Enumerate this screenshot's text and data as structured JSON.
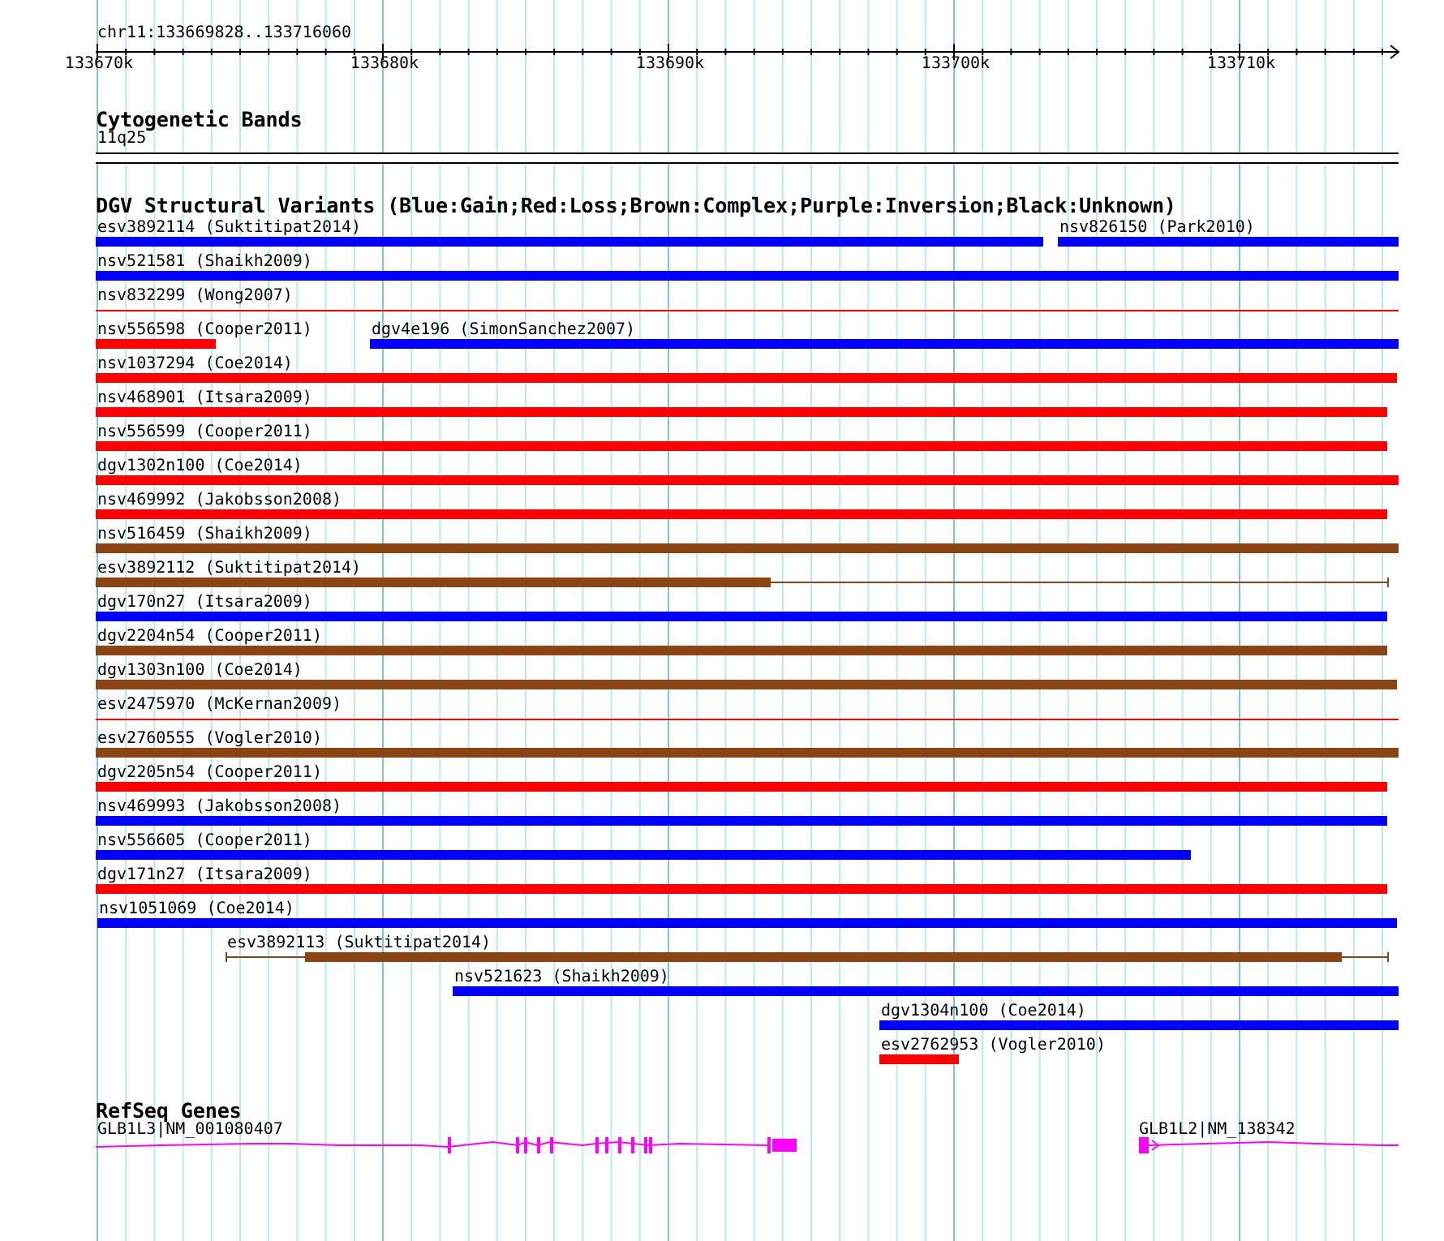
{
  "locus": "chr11:133669828..133716060",
  "ruler": {
    "labels": [
      "133670k",
      "133680k",
      "133690k",
      "133700k",
      "133710k"
    ]
  },
  "cytoband_track": {
    "title": "Cytogenetic Bands",
    "band": "11q25"
  },
  "variants_track": {
    "title": "DGV Structural Variants (Blue:Gain;Red:Loss;Brown:Complex;Purple:Inversion;Black:Unknown)",
    "rows": [
      {
        "features": [
          {
            "label": "esv3892114 (Suktitipat2014)",
            "color": "#0000ff",
            "kind": "bar"
          },
          {
            "label": "nsv826150 (Park2010)",
            "color": "#0000ff",
            "kind": "bar"
          }
        ]
      },
      {
        "features": [
          {
            "label": "nsv521581 (Shaikh2009)",
            "color": "#0000ff",
            "kind": "bar"
          }
        ]
      },
      {
        "features": [
          {
            "label": "nsv832299 (Wong2007)",
            "color": "#ff0000",
            "kind": "line"
          }
        ]
      },
      {
        "features": [
          {
            "label": "nsv556598 (Cooper2011)",
            "color": "#ff0000",
            "kind": "bar"
          },
          {
            "label": "dgv4e196 (SimonSanchez2007)",
            "color": "#0000ff",
            "kind": "bar"
          }
        ]
      },
      {
        "features": [
          {
            "label": "nsv1037294 (Coe2014)",
            "color": "#ff0000",
            "kind": "bar"
          }
        ]
      },
      {
        "features": [
          {
            "label": "nsv468901 (Itsara2009)",
            "color": "#ff0000",
            "kind": "bar"
          }
        ]
      },
      {
        "features": [
          {
            "label": "nsv556599 (Cooper2011)",
            "color": "#ff0000",
            "kind": "bar"
          }
        ]
      },
      {
        "features": [
          {
            "label": "dgv1302n100 (Coe2014)",
            "color": "#ff0000",
            "kind": "bar"
          }
        ]
      },
      {
        "features": [
          {
            "label": "nsv469992 (Jakobsson2008)",
            "color": "#ff0000",
            "kind": "bar"
          }
        ]
      },
      {
        "features": [
          {
            "label": "nsv516459 (Shaikh2009)",
            "color": "#8b4513",
            "kind": "bar"
          }
        ]
      },
      {
        "features": [
          {
            "label": "esv3892112 (Suktitipat2014)",
            "color": "#8b4513",
            "kind": "split"
          }
        ]
      },
      {
        "features": [
          {
            "label": "dgv170n27 (Itsara2009)",
            "color": "#0000ff",
            "kind": "bar"
          }
        ]
      },
      {
        "features": [
          {
            "label": "dgv2204n54 (Cooper2011)",
            "color": "#8b4513",
            "kind": "bar"
          }
        ]
      },
      {
        "features": [
          {
            "label": "dgv1303n100 (Coe2014)",
            "color": "#8b4513",
            "kind": "bar"
          }
        ]
      },
      {
        "features": [
          {
            "label": "esv2475970 (McKernan2009)",
            "color": "#ff0000",
            "kind": "line"
          }
        ]
      },
      {
        "features": [
          {
            "label": "esv2760555 (Vogler2010)",
            "color": "#8b4513",
            "kind": "bar"
          }
        ]
      },
      {
        "features": [
          {
            "label": "dgv2205n54 (Cooper2011)",
            "color": "#ff0000",
            "kind": "bar"
          }
        ]
      },
      {
        "features": [
          {
            "label": "nsv469993 (Jakobsson2008)",
            "color": "#0000ff",
            "kind": "bar"
          }
        ]
      },
      {
        "features": [
          {
            "label": "nsv556605 (Cooper2011)",
            "color": "#0000ff",
            "kind": "bar"
          }
        ]
      },
      {
        "features": [
          {
            "label": "dgv171n27 (Itsara2009)",
            "color": "#ff0000",
            "kind": "bar"
          }
        ]
      },
      {
        "features": [
          {
            "label": "nsv1051069 (Coe2014)",
            "color": "#0000ff",
            "kind": "bar"
          }
        ]
      },
      {
        "features": [
          {
            "label": "esv3892113 (Suktitipat2014)",
            "color": "#8b4513",
            "kind": "split"
          }
        ]
      },
      {
        "features": [
          {
            "label": "nsv521623 (Shaikh2009)",
            "color": "#0000ff",
            "kind": "bar"
          }
        ]
      },
      {
        "features": [
          {
            "label": "dgv1304n100 (Coe2014)",
            "color": "#0000ff",
            "kind": "bar"
          }
        ]
      },
      {
        "features": [
          {
            "label": "esv2762953 (Vogler2010)",
            "color": "#ff0000",
            "kind": "bar"
          }
        ]
      }
    ]
  },
  "genes_track": {
    "title": "RefSeq Genes",
    "genes": [
      {
        "label": "GLB1L3|NM_001080407"
      },
      {
        "label": "GLB1L2|NM_138342"
      }
    ]
  }
}
